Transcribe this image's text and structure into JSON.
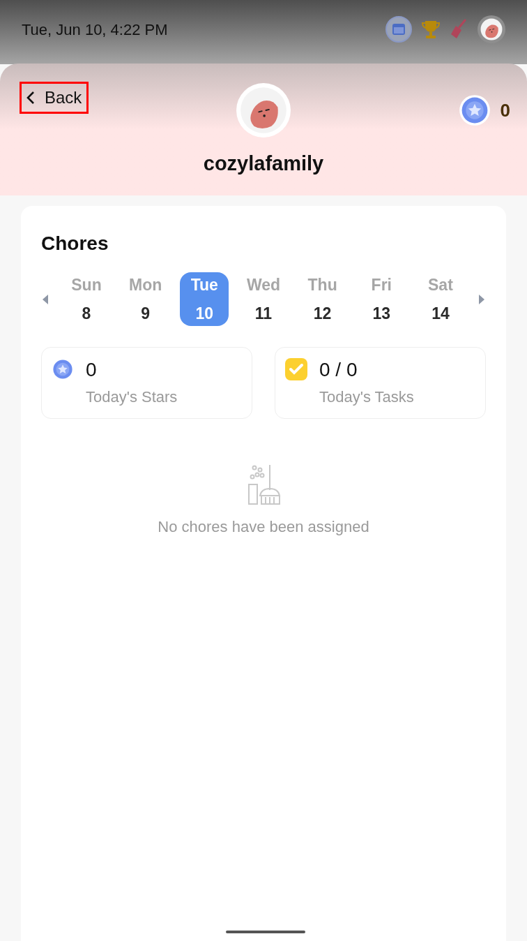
{
  "status_bar": {
    "datetime": "Tue, Jun 10, 4:22 PM"
  },
  "header": {
    "back_label": "Back",
    "back_highlighted": true,
    "username": "cozylafamily",
    "star_count": "0"
  },
  "chores": {
    "title": "Chores",
    "days": [
      {
        "weekday": "Sun",
        "date": "8",
        "selected": false
      },
      {
        "weekday": "Mon",
        "date": "9",
        "selected": false
      },
      {
        "weekday": "Tue",
        "date": "10",
        "selected": true
      },
      {
        "weekday": "Wed",
        "date": "11",
        "selected": false
      },
      {
        "weekday": "Thu",
        "date": "12",
        "selected": false
      },
      {
        "weekday": "Fri",
        "date": "13",
        "selected": false
      },
      {
        "weekday": "Sat",
        "date": "14",
        "selected": false
      }
    ],
    "stats": [
      {
        "kind": "stars",
        "value": "0",
        "label": "Today's Stars"
      },
      {
        "kind": "tasks",
        "value": "0 / 0",
        "label": "Today's Tasks"
      }
    ],
    "empty_message": "No chores have been assigned"
  }
}
